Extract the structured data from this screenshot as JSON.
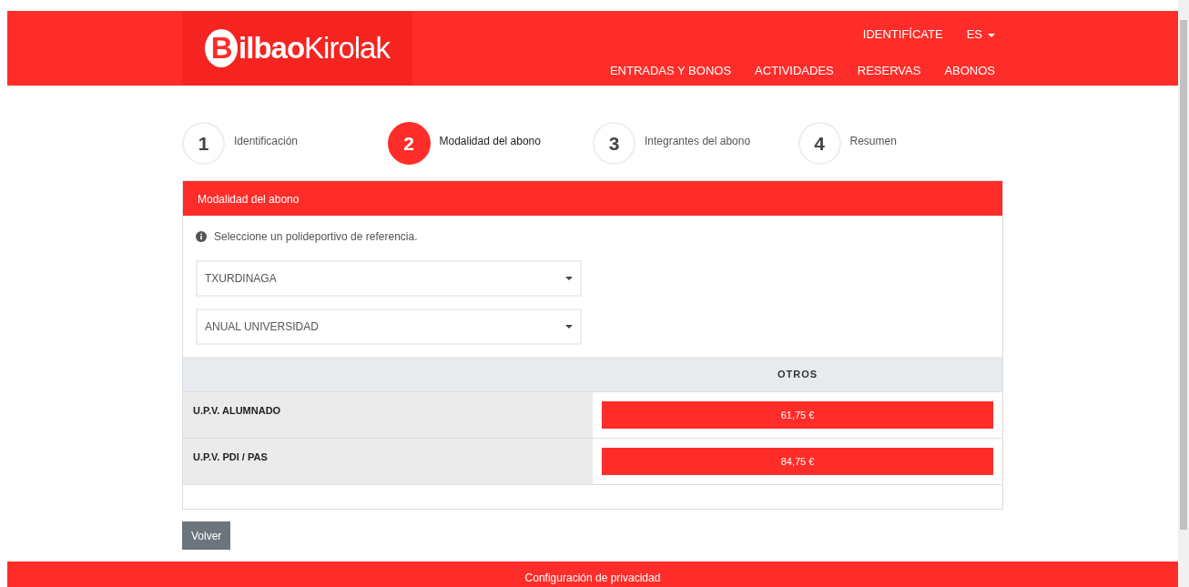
{
  "header": {
    "logo": {
      "initial": "B",
      "bold": "ilbao",
      "rest": "Kirolak"
    },
    "top_links": [
      {
        "label": "IDENTIFÍCATE",
        "kind": "link"
      },
      {
        "label": "ES",
        "kind": "dropdown"
      }
    ],
    "nav": [
      "ENTRADAS Y BONOS",
      "ACTIVIDADES",
      "RESERVAS",
      "ABONOS"
    ]
  },
  "steps": [
    {
      "number": "1",
      "label": "Identificación",
      "selected": false
    },
    {
      "number": "2",
      "label": "Modalidad del abono",
      "selected": true
    },
    {
      "number": "3",
      "label": "Integrantes del abono",
      "selected": false
    },
    {
      "number": "4",
      "label": "Resumen",
      "selected": false
    }
  ],
  "card": {
    "title": "Modalidad del abono",
    "info": "Seleccione un polideportivo de referencia.",
    "selects": [
      {
        "value": "TXURDINAGA"
      },
      {
        "value": "ANUAL UNIVERSIDAD"
      }
    ],
    "table": {
      "columns": [
        "OTROS"
      ],
      "rows": [
        {
          "label": "U.P.V. ALUMNADO",
          "price": "61,75 €"
        },
        {
          "label": "U.P.V. PDI / PAS",
          "price": "84,75 €"
        }
      ]
    }
  },
  "back_button": "Volver",
  "footer": {
    "link": "Configuración de privacidad"
  }
}
